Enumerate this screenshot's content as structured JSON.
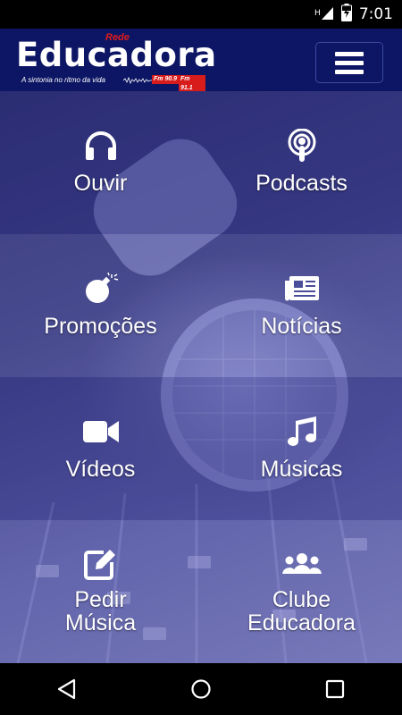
{
  "status_bar": {
    "time": "7:01",
    "icons": [
      "signal-icon",
      "battery-charging-icon"
    ]
  },
  "header": {
    "logo": {
      "prefix": "Rede",
      "brand": "Educadora",
      "slogan": "A sintonia no ritmo da vida",
      "frequency_1": "Fm 90.9",
      "frequency_2": "Fm 91.1"
    },
    "menu_icon": "hamburger-menu-icon"
  },
  "tiles": [
    {
      "label": "Ouvir",
      "icon": "headphones-icon"
    },
    {
      "label": "Podcasts",
      "icon": "podcast-icon"
    },
    {
      "label": "Promoções",
      "icon": "bomb-icon"
    },
    {
      "label": "Notícias",
      "icon": "newspaper-icon"
    },
    {
      "label": "Vídeos",
      "icon": "video-camera-icon"
    },
    {
      "label": "Músicas",
      "icon": "music-note-icon"
    },
    {
      "label": "Pedir\nMúsica",
      "icon": "edit-icon"
    },
    {
      "label": "Clube\nEducadora",
      "icon": "users-icon"
    }
  ],
  "colors": {
    "header_bg": "#0d1664",
    "accent_red": "#e01b1b",
    "tile_text": "#ffffff"
  },
  "nav_bar": {
    "buttons": [
      "back-icon",
      "home-icon",
      "recents-icon"
    ]
  }
}
